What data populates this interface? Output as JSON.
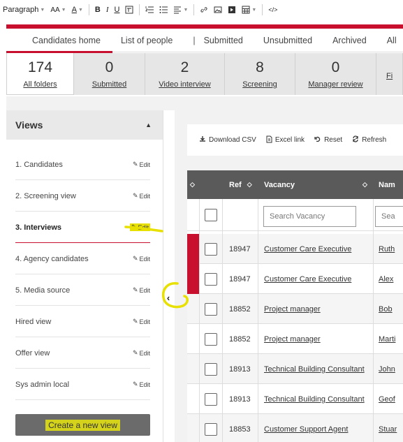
{
  "editor_toolbar": {
    "paragraph": "Paragraph",
    "font_size": "AA",
    "font_color": "A",
    "bold": "B",
    "italic": "I",
    "underline": "U",
    "code": "</>"
  },
  "nav": {
    "items": [
      "Candidates home",
      "List of people",
      "|",
      "Submitted",
      "Unsubmitted",
      "Archived",
      "All"
    ]
  },
  "stats": [
    {
      "count": "174",
      "label": "All folders"
    },
    {
      "count": "0",
      "label": "Submitted"
    },
    {
      "count": "2",
      "label": "Video interview"
    },
    {
      "count": "8",
      "label": "Screening"
    },
    {
      "count": "0",
      "label": "Manager review"
    },
    {
      "count": "",
      "label": "Fi"
    }
  ],
  "sidebar": {
    "title": "Views",
    "edit_label": "Edit",
    "items": [
      "1. Candidates",
      "2. Screening view",
      "3. Interviews",
      "4. Agency candidates",
      "5. Media source",
      "Hired view",
      "Offer view",
      "Sys admin local"
    ],
    "create_button": "Create a new view"
  },
  "actions": {
    "download": "Download CSV",
    "excel": "Excel link",
    "reset": "Reset",
    "refresh": "Refresh"
  },
  "grid": {
    "headers": {
      "ref": "Ref",
      "vacancy": "Vacancy",
      "name": "Nam"
    },
    "search_vacancy": "Search Vacancy",
    "search_name": "Sea",
    "rows": [
      {
        "ref": "18947",
        "vacancy": "Customer Care Executive",
        "name": "Ruth"
      },
      {
        "ref": "18947",
        "vacancy": "Customer Care Executive",
        "name": "Alex"
      },
      {
        "ref": "18852",
        "vacancy": "Project manager",
        "name": "Bob"
      },
      {
        "ref": "18852",
        "vacancy": "Project manager",
        "name": "Marti"
      },
      {
        "ref": "18913",
        "vacancy": "Technical Building Consultant",
        "name": "John"
      },
      {
        "ref": "18913",
        "vacancy": "Technical Building Consultant",
        "name": "Geof"
      },
      {
        "ref": "18853",
        "vacancy": "Customer Support Agent",
        "name": "Stuar"
      }
    ]
  },
  "colors": {
    "brand_red": "#c8102e",
    "header_gray": "#5a5a5a",
    "annotation_yellow": "#e8e000"
  }
}
